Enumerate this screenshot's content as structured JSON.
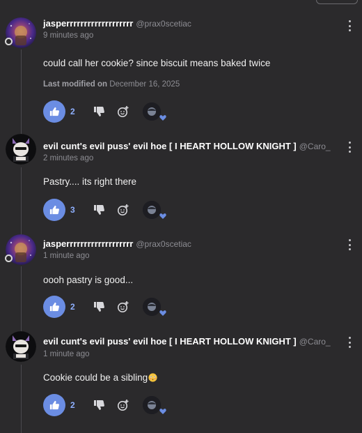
{
  "colors": {
    "background": "#2b2a2c",
    "like_active": "#6b8de3",
    "like_count": "#8fb0ff",
    "muted_text": "#8d8d93"
  },
  "comments": [
    {
      "author": "jasperrrrrrrrrrrrrrrrrrr",
      "handle": "@prax0scetiac",
      "time": "9 minutes ago",
      "text": "could call her cookie? since biscuit means baked twice",
      "modified_label": "Last modified on",
      "modified_date": "December 16, 2025",
      "likes": "2",
      "avatar": "galaxy-avatar",
      "has_status_dot": true
    },
    {
      "author": "evil cunt's evil puss' evil hoe [ I HEART HOLLOW KNIGHT ]",
      "handle": "@Caro_",
      "time": "2 minutes ago",
      "text": "Pastry.... its right there",
      "likes": "3",
      "avatar": "cat-avatar",
      "has_status_dot": false
    },
    {
      "author": "jasperrrrrrrrrrrrrrrrrrr",
      "handle": "@prax0scetiac",
      "time": "1 minute ago",
      "text": "oooh pastry is good...",
      "likes": "2",
      "avatar": "galaxy-avatar",
      "has_status_dot": true
    },
    {
      "author": "evil cunt's evil puss' evil hoe [ I HEART HOLLOW KNIGHT ]",
      "handle": "@Caro_",
      "time": "1 minute ago",
      "text": "Cookie could be a sibling",
      "text_emoji": "flushed-face-emoji",
      "likes": "2",
      "avatar": "cat-avatar",
      "has_status_dot": false
    }
  ],
  "icons": {
    "like": "thumbs-up-icon",
    "dislike": "thumbs-down-icon",
    "react": "add-reaction-icon",
    "reactor_heart": "heart-icon",
    "menu": "kebab-menu-icon"
  }
}
